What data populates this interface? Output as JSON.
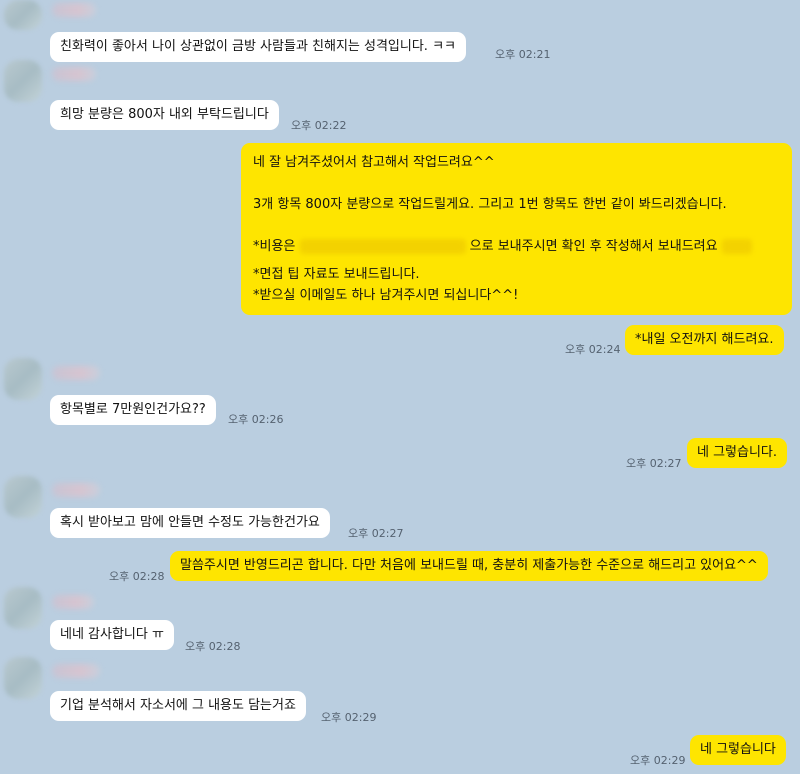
{
  "messages": {
    "m1": {
      "text": "친화력이 좋아서 나이 상관없이 금방 사람들과 친해지는 성격입니다. ㅋㅋ",
      "time": "오후 02:21"
    },
    "m2": {
      "text": "희망 분량은 800자 내외 부탁드립니다",
      "time": "오후 02:22"
    },
    "m3": {
      "line1": "네 잘 남겨주셨어서 참고해서 작업드려요^^",
      "line2": "3개 항목 800자 분량으로 작업드릴게요. 그리고 1번 항목도 한번 같이 봐드리겠습니다.",
      "line3_prefix": "*비용은",
      "line3_suffix": "으로 보내주시면 확인 후 작성해서 보내드려요",
      "line4": "*면접 팁 자료도 보내드립니다.",
      "line5": "*받으실 이메일도 하나 남겨주시면 되십니다^^!"
    },
    "m4": {
      "text": "*내일 오전까지 해드려요.",
      "time": "오후 02:24"
    },
    "m5": {
      "text": "항목별로 7만원인건가요??",
      "time": "오후 02:26"
    },
    "m6": {
      "text": "네 그렇습니다.",
      "time": "오후 02:27"
    },
    "m7": {
      "text": "혹시 받아보고 맘에 안들면 수정도 가능한건가요",
      "time": "오후 02:27"
    },
    "m8": {
      "text": "말씀주시면 반영드리곤 합니다. 다만 처음에 보내드릴 때, 충분히 제출가능한 수준으로 해드리고 있어요^^",
      "time": "오후 02:28"
    },
    "m9": {
      "text": "네네 감사합니다 ㅠ",
      "time": "오후 02:28"
    },
    "m10": {
      "text": "기업 분석해서 자소서에 그 내용도 담는거죠",
      "time": "오후 02:29"
    },
    "m11": {
      "text": "네 그렇습니다",
      "time": "오후 02:29"
    }
  },
  "colors": {
    "background": "#bacee0",
    "incoming_bubble": "#ffffff",
    "outgoing_bubble": "#fee500",
    "timestamp": "#556270"
  }
}
